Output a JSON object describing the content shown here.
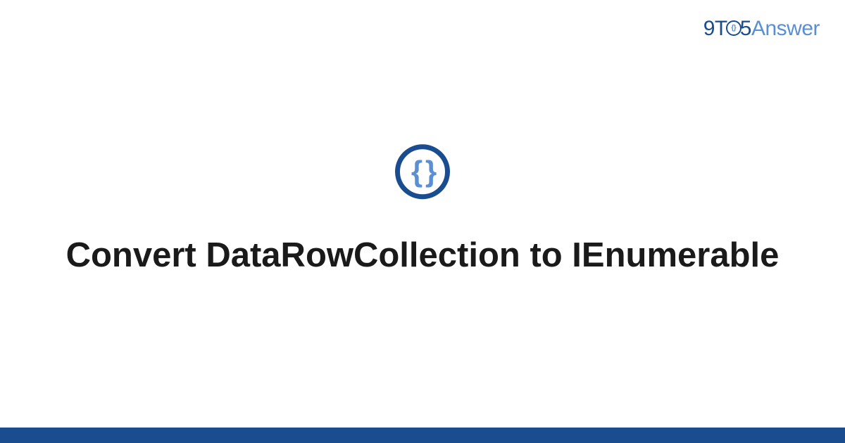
{
  "brand": {
    "part1": "9T",
    "part2": "5",
    "part3": "Answer"
  },
  "icon": {
    "name": "code-braces-icon",
    "glyph": "{ }"
  },
  "title": "Convert DataRowCollection to IEnumerable",
  "colors": {
    "primary": "#1a4d8f",
    "accent": "#5a8fd4",
    "text": "#1a1a1a"
  }
}
